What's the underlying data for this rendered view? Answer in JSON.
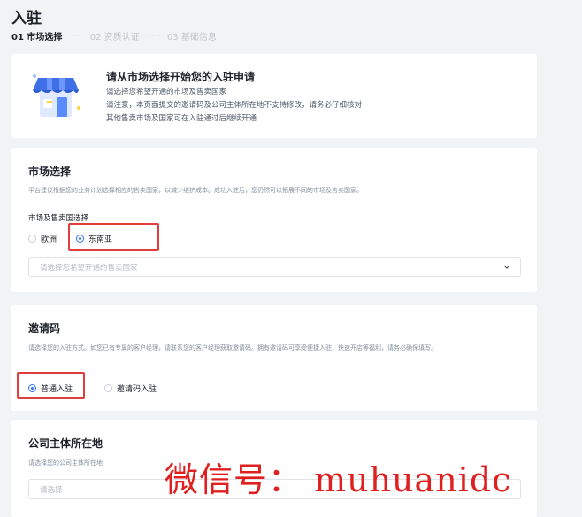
{
  "page": {
    "title": "入驻"
  },
  "steps": [
    {
      "label": "01 市场选择"
    },
    {
      "label": "02 资质认证"
    },
    {
      "label": "03 基础信息"
    }
  ],
  "steps_separator": "·····",
  "intro": {
    "title": "请从市场选择开始您的入驻申请",
    "lines": [
      "请选择您希望开通的市场及售卖国家",
      "请注意，本页面提交的邀请码及公司主体所在地不支持修改，请务必仔细核对",
      "其他售卖市场及国家可在入驻通过后继续开通"
    ]
  },
  "market": {
    "title": "市场选择",
    "description": "平台建议根据您的业务计划选择相应的售卖国家，以减少维护成本。成功入驻后，您仍然可以拓展不同的市场及售卖国家。",
    "field_label": "市场及售卖国选择",
    "options": [
      {
        "label": "欧洲",
        "checked": false
      },
      {
        "label": "东南亚",
        "checked": true
      }
    ],
    "select_placeholder": "请选择您希望开通的售卖国家"
  },
  "invite": {
    "title": "邀请码",
    "description": "请选择您的入驻方式。如您已有专属的客户经理，请联系您的客户经理获取邀请码。拥有邀请码可享受便捷入驻、快速开店等福利，请务必确保填写。",
    "options": [
      {
        "label": "普通入驻",
        "checked": true
      },
      {
        "label": "邀请码入驻",
        "checked": false
      }
    ]
  },
  "company": {
    "title": "公司主体所在地",
    "description": "请选择您的公司主体所在地",
    "select_placeholder": "请选择"
  },
  "watermark": "微信号： muhuanidc",
  "colors": {
    "accent": "#3370ff",
    "highlight": "#e13d3d",
    "watermark": "#e02020",
    "background": "#f2f3f5"
  }
}
